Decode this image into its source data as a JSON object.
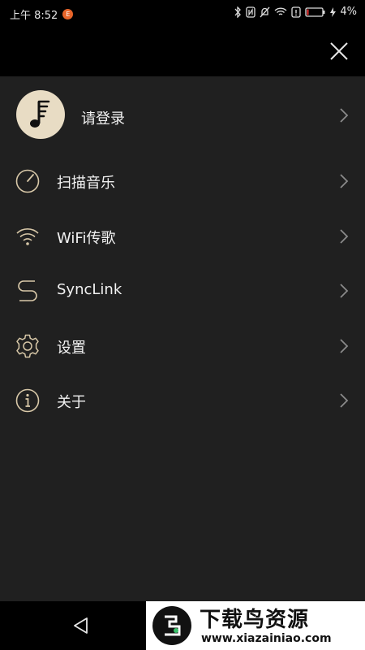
{
  "status_bar": {
    "time": "上午 8:52",
    "notification_badge": "E",
    "battery": "4%"
  },
  "menu": {
    "login": {
      "label": "请登录",
      "icon": "music-note-icon"
    },
    "items": [
      {
        "label": "扫描音乐",
        "icon": "scan-dial-icon"
      },
      {
        "label": "WiFi传歌",
        "icon": "wifi-icon"
      },
      {
        "label": "SyncLink",
        "icon": "synclink-s-icon"
      },
      {
        "label": "设置",
        "icon": "gear-icon"
      },
      {
        "label": "关于",
        "icon": "info-icon"
      }
    ]
  },
  "watermark": {
    "title": "下载鸟资源",
    "url": "www.xiazainiao.com"
  },
  "colors": {
    "accent_gold": "#d8c8a8",
    "background": "#202020",
    "bar": "#000000",
    "chevron": "#8a8a8a"
  }
}
